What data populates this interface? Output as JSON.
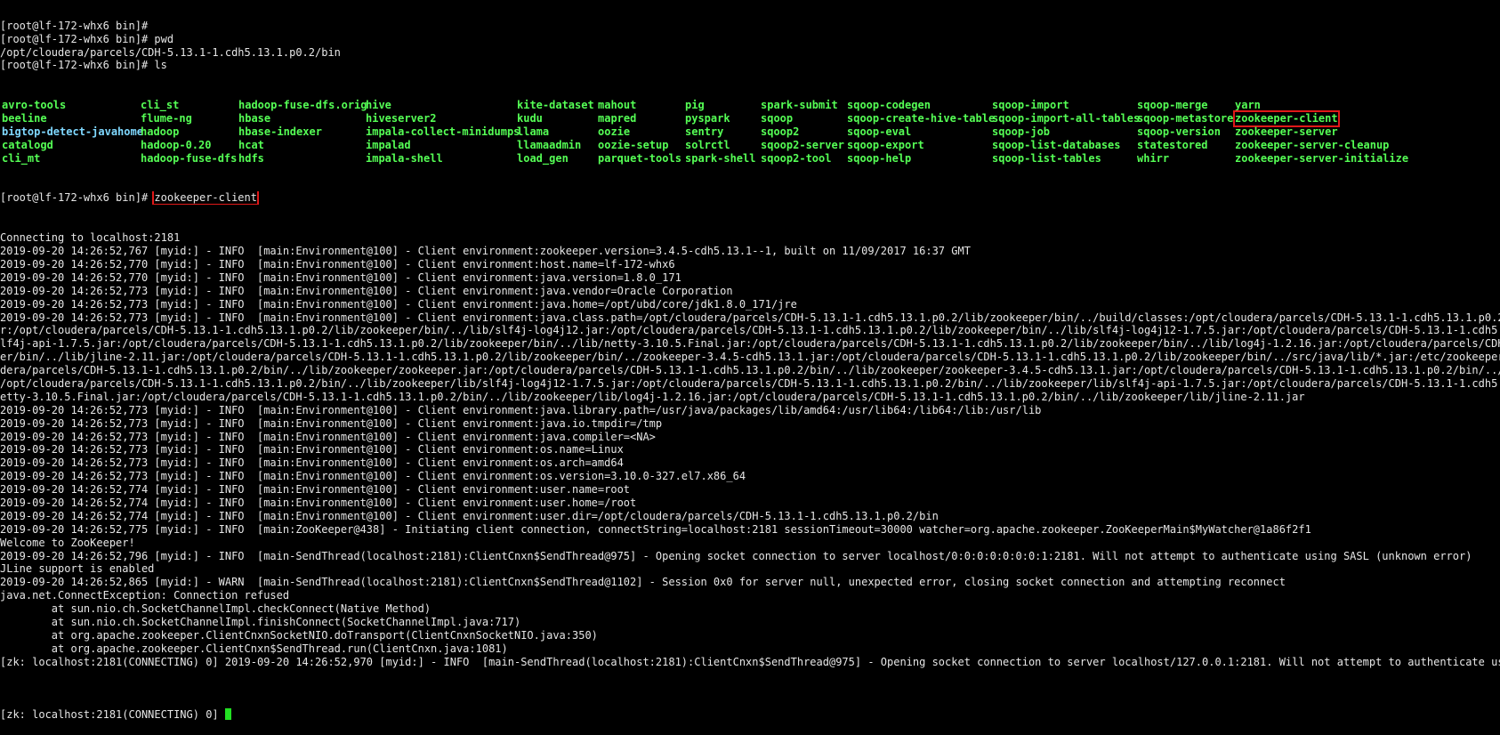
{
  "terminal": {
    "intro_lines": [
      "[root@lf-172-whx6 bin]#",
      "[root@lf-172-whx6 bin]# pwd",
      "/opt/cloudera/parcels/CDH-5.13.1-1.cdh5.13.1.p0.2/bin",
      "[root@lf-172-whx6 bin]# ls"
    ],
    "ls_columns": [
      [
        "avro-tools",
        "beeline",
        "bigtop-detect-javahome",
        "catalogd",
        "cli_mt"
      ],
      [
        "cli_st",
        "flume-ng",
        "hadoop",
        "hadoop-0.20",
        "hadoop-fuse-dfs"
      ],
      [
        "hadoop-fuse-dfs.orig",
        "hbase",
        "hbase-indexer",
        "hcat",
        "hdfs"
      ],
      [
        "hive",
        "hiveserver2",
        "impala-collect-minidumps",
        "impalad",
        "impala-shell"
      ],
      [
        "kite-dataset",
        "kudu",
        "llama",
        "llamaadmin",
        "load_gen"
      ],
      [
        "mahout",
        "mapred",
        "oozie",
        "oozie-setup",
        "parquet-tools"
      ],
      [
        "pig",
        "pyspark",
        "sentry",
        "solrctl",
        "spark-shell"
      ],
      [
        "spark-submit",
        "sqoop",
        "sqoop2",
        "sqoop2-server",
        "sqoop2-tool"
      ],
      [
        "sqoop-codegen",
        "sqoop-create-hive-table",
        "sqoop-eval",
        "sqoop-export",
        "sqoop-help"
      ],
      [
        "sqoop-import",
        "sqoop-import-all-tables",
        "sqoop-job",
        "sqoop-list-databases",
        "sqoop-list-tables"
      ],
      [
        "sqoop-merge",
        "sqoop-metastore",
        "sqoop-version",
        "statestored",
        "whirr"
      ],
      [
        "yarn",
        "zookeeper-client",
        "zookeeper-server",
        "zookeeper-server-cleanup",
        "zookeeper-server-initialize"
      ]
    ],
    "command_prompt": "[root@lf-172-whx6 bin]# ",
    "command_text": "zookeeper-client",
    "output_lines": [
      "Connecting to localhost:2181",
      "2019-09-20 14:26:52,767 [myid:] - INFO  [main:Environment@100] - Client environment:zookeeper.version=3.4.5-cdh5.13.1--1, built on 11/09/2017 16:37 GMT",
      "2019-09-20 14:26:52,770 [myid:] - INFO  [main:Environment@100] - Client environment:host.name=lf-172-whx6",
      "2019-09-20 14:26:52,770 [myid:] - INFO  [main:Environment@100] - Client environment:java.version=1.8.0_171",
      "2019-09-20 14:26:52,773 [myid:] - INFO  [main:Environment@100] - Client environment:java.vendor=Oracle Corporation",
      "2019-09-20 14:26:52,773 [myid:] - INFO  [main:Environment@100] - Client environment:java.home=/opt/ubd/core/jdk1.8.0_171/jre",
      "2019-09-20 14:26:52,773 [myid:] - INFO  [main:Environment@100] - Client environment:java.class.path=/opt/cloudera/parcels/CDH-5.13.1-1.cdh5.13.1.p0.2/lib/zookeeper/bin/../build/classes:/opt/cloudera/parcels/CDH-5.13.1-1.cdh5.13.1.p0.2/lib/zoo",
      "r:/opt/cloudera/parcels/CDH-5.13.1-1.cdh5.13.1.p0.2/lib/zookeeper/bin/../lib/slf4j-log4j12.jar:/opt/cloudera/parcels/CDH-5.13.1-1.cdh5.13.1.p0.2/lib/zookeeper/bin/../lib/slf4j-log4j12-1.7.5.jar:/opt/cloudera/parcels/CDH-5.13.1-1.cdh5.13.1.p0",
      "lf4j-api-1.7.5.jar:/opt/cloudera/parcels/CDH-5.13.1-1.cdh5.13.1.p0.2/lib/zookeeper/bin/../lib/netty-3.10.5.Final.jar:/opt/cloudera/parcels/CDH-5.13.1-1.cdh5.13.1.p0.2/lib/zookeeper/bin/../lib/log4j-1.2.16.jar:/opt/cloudera/parcels/CDH-5.13.1",
      "er/bin/../lib/jline-2.11.jar:/opt/cloudera/parcels/CDH-5.13.1-1.cdh5.13.1.p0.2/lib/zookeeper/bin/../zookeeper-3.4.5-cdh5.13.1.jar:/opt/cloudera/parcels/CDH-5.13.1-1.cdh5.13.1.p0.2/lib/zookeeper/bin/../src/java/lib/*.jar:/etc/zookeeper/conf:",
      "dera/parcels/CDH-5.13.1-1.cdh5.13.1.p0.2/bin/../lib/zookeeper/zookeeper.jar:/opt/cloudera/parcels/CDH-5.13.1-1.cdh5.13.1.p0.2/bin/../lib/zookeeper/zookeeper-3.4.5-cdh5.13.1.jar:/opt/cloudera/parcels/CDH-5.13.1-1.cdh5.13.1.p0.2/bin/../lib/zoo",
      "/opt/cloudera/parcels/CDH-5.13.1-1.cdh5.13.1.p0.2/bin/../lib/zookeeper/lib/slf4j-log4j12-1.7.5.jar:/opt/cloudera/parcels/CDH-5.13.1-1.cdh5.13.1.p0.2/bin/../lib/zookeeper/lib/slf4j-api-1.7.5.jar:/opt/cloudera/parcels/CDH-5.13.1-1.cdh5.13.1.p",
      "etty-3.10.5.Final.jar:/opt/cloudera/parcels/CDH-5.13.1-1.cdh5.13.1.p0.2/bin/../lib/zookeeper/lib/log4j-1.2.16.jar:/opt/cloudera/parcels/CDH-5.13.1-1.cdh5.13.1.p0.2/bin/../lib/zookeeper/lib/jline-2.11.jar",
      "2019-09-20 14:26:52,773 [myid:] - INFO  [main:Environment@100] - Client environment:java.library.path=/usr/java/packages/lib/amd64:/usr/lib64:/lib64:/lib:/usr/lib",
      "2019-09-20 14:26:52,773 [myid:] - INFO  [main:Environment@100] - Client environment:java.io.tmpdir=/tmp",
      "2019-09-20 14:26:52,773 [myid:] - INFO  [main:Environment@100] - Client environment:java.compiler=<NA>",
      "2019-09-20 14:26:52,773 [myid:] - INFO  [main:Environment@100] - Client environment:os.name=Linux",
      "2019-09-20 14:26:52,773 [myid:] - INFO  [main:Environment@100] - Client environment:os.arch=amd64",
      "2019-09-20 14:26:52,773 [myid:] - INFO  [main:Environment@100] - Client environment:os.version=3.10.0-327.el7.x86_64",
      "2019-09-20 14:26:52,774 [myid:] - INFO  [main:Environment@100] - Client environment:user.name=root",
      "2019-09-20 14:26:52,774 [myid:] - INFO  [main:Environment@100] - Client environment:user.home=/root",
      "2019-09-20 14:26:52,774 [myid:] - INFO  [main:Environment@100] - Client environment:user.dir=/opt/cloudera/parcels/CDH-5.13.1-1.cdh5.13.1.p0.2/bin",
      "2019-09-20 14:26:52,775 [myid:] - INFO  [main:ZooKeeper@438] - Initiating client connection, connectString=localhost:2181 sessionTimeout=30000 watcher=org.apache.zookeeper.ZooKeeperMain$MyWatcher@1a86f2f1",
      "Welcome to ZooKeeper!",
      "2019-09-20 14:26:52,796 [myid:] - INFO  [main-SendThread(localhost:2181):ClientCnxn$SendThread@975] - Opening socket connection to server localhost/0:0:0:0:0:0:0:1:2181. Will not attempt to authenticate using SASL (unknown error)",
      "JLine support is enabled",
      "2019-09-20 14:26:52,865 [myid:] - WARN  [main-SendThread(localhost:2181):ClientCnxn$SendThread@1102] - Session 0x0 for server null, unexpected error, closing socket connection and attempting reconnect",
      "java.net.ConnectException: Connection refused",
      "        at sun.nio.ch.SocketChannelImpl.checkConnect(Native Method)",
      "        at sun.nio.ch.SocketChannelImpl.finishConnect(SocketChannelImpl.java:717)",
      "        at org.apache.zookeeper.ClientCnxnSocketNIO.doTransport(ClientCnxnSocketNIO.java:350)",
      "        at org.apache.zookeeper.ClientCnxn$SendThread.run(ClientCnxn.java:1081)",
      "[zk: localhost:2181(CONNECTING) 0] 2019-09-20 14:26:52,970 [myid:] - INFO  [main-SendThread(localhost:2181):ClientCnxn$SendThread@975] - Opening socket connection to server localhost/127.0.0.1:2181. Will not attempt to authenticate using SAS",
      ""
    ],
    "final_prompt": "[zk: localhost:2181(CONNECTING) 0] ",
    "colors": {
      "background": "#000000",
      "text": "#e6e6e6",
      "executable": "#55ff55",
      "symlink": "#7fd8ff",
      "highlight_box": "#e01818",
      "cursor": "#22e022"
    }
  }
}
